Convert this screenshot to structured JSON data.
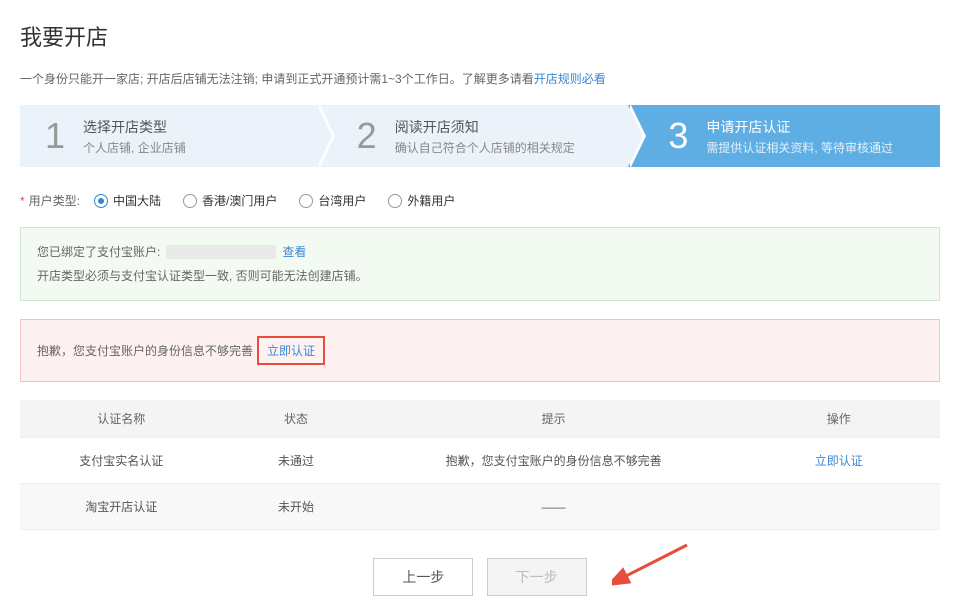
{
  "page": {
    "title": "我要开店",
    "subtitle_a": "一个身份只能开一家店; 开店后店铺无法注销; 申请到正式开通预计需1~3个工作日。了解更多请看",
    "subtitle_link": "开店规则必看"
  },
  "steps": [
    {
      "num": "1",
      "title": "选择开店类型",
      "desc": "个人店铺, 企业店铺",
      "active": false
    },
    {
      "num": "2",
      "title": "阅读开店须知",
      "desc": "确认自己符合个人店铺的相关规定",
      "active": false
    },
    {
      "num": "3",
      "title": "申请开店认证",
      "desc": "需提供认证相关资料, 等待审核通过",
      "active": true
    }
  ],
  "user_type": {
    "required": "*",
    "label": "用户类型:",
    "options": [
      {
        "label": "中国大陆",
        "checked": true
      },
      {
        "label": "香港/澳门用户",
        "checked": false
      },
      {
        "label": "台湾用户",
        "checked": false
      },
      {
        "label": "外籍用户",
        "checked": false
      }
    ]
  },
  "info_box": {
    "line1_prefix": "您已绑定了支付宝账户:",
    "view_link": "查看",
    "line2": "开店类型必须与支付宝认证类型一致, 否则可能无法创建店铺。"
  },
  "error_box": {
    "text": "抱歉，您支付宝账户的身份信息不够完善",
    "link": "立即认证"
  },
  "table": {
    "headers": [
      "认证名称",
      "状态",
      "提示",
      "操作"
    ],
    "rows": [
      {
        "name": "支付宝实名认证",
        "status": "未通过",
        "status_class": "fail",
        "hint": "抱歉，您支付宝账户的身份信息不够完善",
        "action": "立即认证"
      },
      {
        "name": "淘宝开店认证",
        "status": "未开始",
        "status_class": "",
        "hint": "——",
        "action": ""
      }
    ]
  },
  "buttons": {
    "prev": "上一步",
    "next": "下一步"
  }
}
